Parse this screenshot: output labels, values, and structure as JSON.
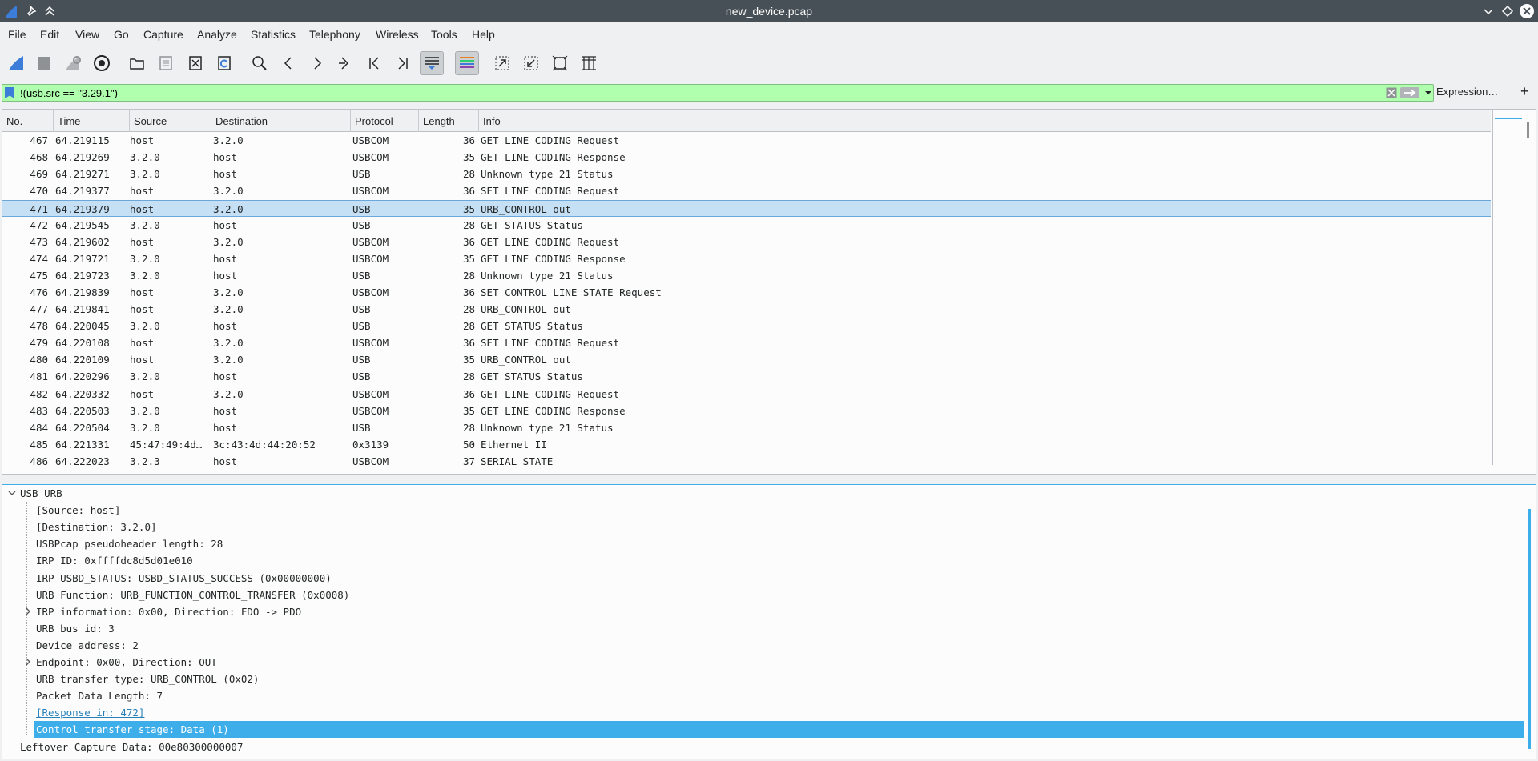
{
  "window": {
    "title": "new_device.pcap"
  },
  "menu": [
    "File",
    "Edit",
    "View",
    "Go",
    "Capture",
    "Analyze",
    "Statistics",
    "Telephony",
    "Wireless",
    "Tools",
    "Help"
  ],
  "filter": {
    "value": "!(usb.src == \"3.29.1\")",
    "expression_label": "Expression…",
    "plus_label": "+"
  },
  "packet_list": {
    "columns": [
      "No.",
      "Time",
      "Source",
      "Destination",
      "Protocol",
      "Length",
      "Info"
    ],
    "rows": [
      [
        "467",
        "64.219115",
        "host",
        "3.2.0",
        "USBCOM",
        "36",
        "GET LINE CODING Request"
      ],
      [
        "468",
        "64.219269",
        "3.2.0",
        "host",
        "USBCOM",
        "35",
        "GET LINE CODING Response"
      ],
      [
        "469",
        "64.219271",
        "3.2.0",
        "host",
        "USB",
        "28",
        "Unknown type 21 Status"
      ],
      [
        "470",
        "64.219377",
        "host",
        "3.2.0",
        "USBCOM",
        "36",
        "SET LINE CODING Request"
      ],
      [
        "471",
        "64.219379",
        "host",
        "3.2.0",
        "USB",
        "35",
        "URB_CONTROL out"
      ],
      [
        "472",
        "64.219545",
        "3.2.0",
        "host",
        "USB",
        "28",
        "GET STATUS Status"
      ],
      [
        "473",
        "64.219602",
        "host",
        "3.2.0",
        "USBCOM",
        "36",
        "GET LINE CODING Request"
      ],
      [
        "474",
        "64.219721",
        "3.2.0",
        "host",
        "USBCOM",
        "35",
        "GET LINE CODING Response"
      ],
      [
        "475",
        "64.219723",
        "3.2.0",
        "host",
        "USB",
        "28",
        "Unknown type 21 Status"
      ],
      [
        "476",
        "64.219839",
        "host",
        "3.2.0",
        "USBCOM",
        "36",
        "SET CONTROL LINE STATE Request"
      ],
      [
        "477",
        "64.219841",
        "host",
        "3.2.0",
        "USB",
        "28",
        "URB_CONTROL out"
      ],
      [
        "478",
        "64.220045",
        "3.2.0",
        "host",
        "USB",
        "28",
        "GET STATUS Status"
      ],
      [
        "479",
        "64.220108",
        "host",
        "3.2.0",
        "USBCOM",
        "36",
        "SET LINE CODING Request"
      ],
      [
        "480",
        "64.220109",
        "host",
        "3.2.0",
        "USB",
        "35",
        "URB_CONTROL out"
      ],
      [
        "481",
        "64.220296",
        "3.2.0",
        "host",
        "USB",
        "28",
        "GET STATUS Status"
      ],
      [
        "482",
        "64.220332",
        "host",
        "3.2.0",
        "USBCOM",
        "36",
        "GET LINE CODING Request"
      ],
      [
        "483",
        "64.220503",
        "3.2.0",
        "host",
        "USBCOM",
        "35",
        "GET LINE CODING Response"
      ],
      [
        "484",
        "64.220504",
        "3.2.0",
        "host",
        "USB",
        "28",
        "Unknown type 21 Status"
      ],
      [
        "485",
        "64.221331",
        "45:47:49:4d…",
        "3c:43:4d:44:20:52",
        "0x3139",
        "50",
        "Ethernet II"
      ],
      [
        "486",
        "64.222023",
        "3.2.3",
        "host",
        "USBCOM",
        "37",
        "SERIAL STATE"
      ]
    ],
    "selected_no": "471"
  },
  "details": [
    {
      "text": "USB URB",
      "expand": "open"
    },
    {
      "text": "[Source: host]"
    },
    {
      "text": "[Destination: 3.2.0]"
    },
    {
      "text": "USBPcap pseudoheader length: 28"
    },
    {
      "text": "IRP ID: 0xffffdc8d5d01e010"
    },
    {
      "text": "IRP USBD_STATUS: USBD_STATUS_SUCCESS (0x00000000)"
    },
    {
      "text": "URB Function: URB_FUNCTION_CONTROL_TRANSFER (0x0008)"
    },
    {
      "text": "IRP information: 0x00, Direction: FDO -> PDO",
      "expand": "closed"
    },
    {
      "text": "URB bus id: 3"
    },
    {
      "text": "Device address: 2"
    },
    {
      "text": "Endpoint: 0x00, Direction: OUT",
      "expand": "closed"
    },
    {
      "text": "URB transfer type: URB_CONTROL (0x02)"
    },
    {
      "text": "Packet Data Length: 7"
    },
    {
      "text": "[Response in: 472]",
      "link": true
    },
    {
      "text": "Control transfer stage: Data (1)",
      "selected": true
    },
    {
      "text": "Leftover Capture Data: 00e80300000007",
      "top": true
    }
  ]
}
